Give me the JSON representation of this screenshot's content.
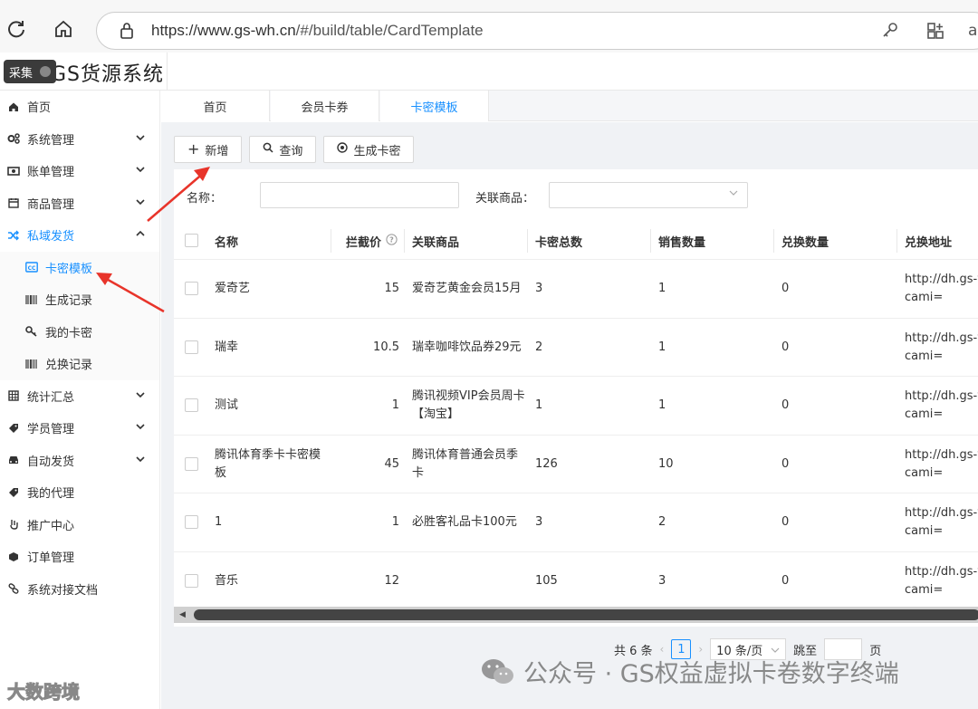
{
  "browser": {
    "url_host": "https://www.gs-wh.cn",
    "url_path": "/#/build/table/CardTemplate"
  },
  "header": {
    "collect_label": "采集",
    "brand_title": "GS货源系统"
  },
  "sidebar": {
    "items": [
      {
        "label": "首页",
        "icon": "home-icon"
      },
      {
        "label": "系统管理",
        "icon": "gears-icon"
      },
      {
        "label": "账单管理",
        "icon": "money-icon"
      },
      {
        "label": "商品管理",
        "icon": "calendar-icon"
      },
      {
        "label": "私域发货",
        "icon": "shuffle-icon"
      },
      {
        "label": "卡密模板",
        "icon": "cc-icon"
      },
      {
        "label": "生成记录",
        "icon": "barcode-icon"
      },
      {
        "label": "我的卡密",
        "icon": "key-icon"
      },
      {
        "label": "兑换记录",
        "icon": "barcode-icon"
      },
      {
        "label": "统计汇总",
        "icon": "table-icon"
      },
      {
        "label": "学员管理",
        "icon": "tag-icon"
      },
      {
        "label": "自动发货",
        "icon": "car-icon"
      },
      {
        "label": "我的代理",
        "icon": "tag-icon"
      },
      {
        "label": "推广中心",
        "icon": "hand-icon"
      },
      {
        "label": "订单管理",
        "icon": "cube-icon"
      },
      {
        "label": "系统对接文档",
        "icon": "link-icon"
      }
    ]
  },
  "tabs": [
    {
      "label": "首页"
    },
    {
      "label": "会员卡券"
    },
    {
      "label": "卡密模板"
    }
  ],
  "toolbar": {
    "add_label": "新增",
    "search_label": "查询",
    "generate_label": "生成卡密"
  },
  "filters": {
    "name_label": "名称：",
    "name_value": "",
    "product_label": "关联商品：",
    "product_value": ""
  },
  "table": {
    "columns": [
      "名称",
      "拦截价",
      "关联商品",
      "卡密总数",
      "销售数量",
      "兑换数量",
      "兑换地址"
    ],
    "rows": [
      {
        "name": "爱奇艺",
        "price": "15",
        "product": "爱奇艺黄金会员15月",
        "total": "3",
        "sold": "1",
        "redeemed": "0",
        "url1": "http://dh.gs-w",
        "url2": "cami="
      },
      {
        "name": "瑞幸",
        "price": "10.5",
        "product": "瑞幸咖啡饮品券29元",
        "total": "2",
        "sold": "1",
        "redeemed": "0",
        "url1": "http://dh.gs-w",
        "url2": "cami="
      },
      {
        "name": "测试",
        "price": "1",
        "product": "腾讯视频VIP会员周卡【淘宝】",
        "total": "1",
        "sold": "1",
        "redeemed": "0",
        "url1": "http://dh.gs-w",
        "url2": "cami="
      },
      {
        "name": "腾讯体育季卡卡密模板",
        "price": "45",
        "product": "腾讯体育普通会员季卡",
        "total": "126",
        "sold": "10",
        "redeemed": "0",
        "url1": "http://dh.gs-w",
        "url2": "cami="
      },
      {
        "name": "1",
        "price": "1",
        "product": "必胜客礼品卡100元",
        "total": "3",
        "sold": "2",
        "redeemed": "0",
        "url1": "http://dh.gs-w",
        "url2": "cami="
      },
      {
        "name": "音乐",
        "price": "12",
        "product": "",
        "total": "105",
        "sold": "3",
        "redeemed": "0",
        "url1": "http://dh.gs-w",
        "url2": "cami="
      }
    ]
  },
  "pagination": {
    "total_text": "共 6 条",
    "current_page": "1",
    "page_size": "10 条/页",
    "jump_label": "跳至",
    "page_suffix": "页"
  },
  "watermark": {
    "text": "公众号 · GS权益虚拟卡卷数字终端",
    "text2": "大数跨境"
  },
  "colors": {
    "accent": "#1890ff",
    "arrow": "#e8342a"
  }
}
